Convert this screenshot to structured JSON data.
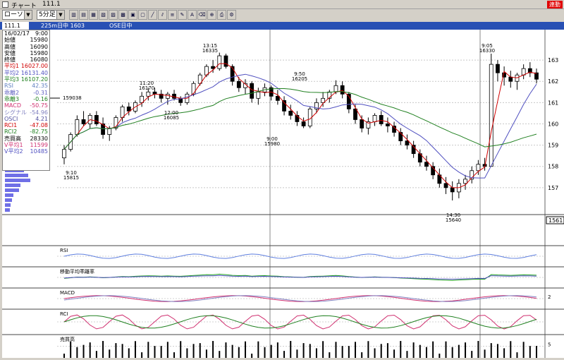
{
  "window": {
    "title": "チャート",
    "symbol": "111.1",
    "link_badge": "連動"
  },
  "toolbar": {
    "chart_type": "ローソク",
    "interval": "5分足",
    "buttons": [
      "chart-a",
      "chart-b",
      "chart-c",
      "chart-d",
      "chart-e",
      "chart-f",
      "chart-g",
      "chart-h",
      "draw-line",
      "draw-channel",
      "draw-fib",
      "draw-pen",
      "draw-text",
      "draw-eraser",
      "zoom",
      "print",
      "settings"
    ]
  },
  "info": {
    "symbol_code": "111.1",
    "contract": "225m日中 1603",
    "market": "OSE日中"
  },
  "data_panel": {
    "date": "16/02/17",
    "time": "9:00",
    "rows": [
      {
        "label": "始値",
        "value": "15980",
        "color": "#000000"
      },
      {
        "label": "高値",
        "value": "16090",
        "color": "#000000"
      },
      {
        "label": "安値",
        "value": "15980",
        "color": "#000000"
      },
      {
        "label": "終値",
        "value": "16080",
        "color": "#000000"
      },
      {
        "label": "平均1",
        "value": "16027.00",
        "color": "#d00000"
      },
      {
        "label": "平均2",
        "value": "16131.40",
        "color": "#5050c0"
      },
      {
        "label": "平均3",
        "value": "16107.20",
        "color": "#208020"
      },
      {
        "label": "RSI",
        "value": "42.35",
        "color": "#6080c0"
      },
      {
        "label": "乖離2",
        "value": "-0.31",
        "color": "#6060c0"
      },
      {
        "label": "乖離3",
        "value": "-0.16",
        "color": "#208020"
      },
      {
        "label": "MACD",
        "value": "-50.75",
        "color": "#d03070"
      },
      {
        "label": "シグナル",
        "value": "-54.96",
        "color": "#8080c0"
      },
      {
        "label": "OSCI",
        "value": "4.21",
        "color": "#5050a0"
      },
      {
        "label": "RCI1",
        "value": "-47.08",
        "color": "#d00000"
      },
      {
        "label": "RCI2",
        "value": "-82.75",
        "color": "#208020"
      },
      {
        "label": "売買高",
        "value": "28330",
        "color": "#000000"
      },
      {
        "label": "V平均1",
        "value": "11599",
        "color": "#d03070"
      },
      {
        "label": "V平均2",
        "value": "10485",
        "color": "#5050c0"
      }
    ]
  },
  "price_axis": {
    "ticks": [
      "163",
      "162",
      "161",
      "160",
      "159",
      "158",
      "157"
    ],
    "current": "1561",
    "marker": "159038"
  },
  "annotations": [
    {
      "time": "9:10",
      "price": "15815"
    },
    {
      "time": "11:20",
      "price": "16170"
    },
    {
      "time": "12:00",
      "price": "16085"
    },
    {
      "time": "13:15",
      "price": "16335"
    },
    {
      "time": "9:50",
      "price": "16205"
    },
    {
      "time": "9:00",
      "price": "15980"
    },
    {
      "time": "14:30",
      "price": "15640"
    },
    {
      "time": "9:05",
      "price": "16330"
    }
  ],
  "sub_panels": [
    {
      "label": "RSI"
    },
    {
      "label": "移動平均乖離率"
    },
    {
      "label": "MACD",
      "axis": "2"
    },
    {
      "label": "RCI"
    },
    {
      "label": "売買高",
      "axis": "5"
    }
  ],
  "volume_profile": [
    14,
    27,
    33,
    36,
    22,
    20,
    12,
    10,
    8,
    7
  ],
  "chart_data": {
    "type": "candlestick",
    "ylim": [
      15600,
      16370
    ],
    "candles": [
      [
        15840,
        15900,
        15810,
        15880
      ],
      [
        15880,
        15960,
        15870,
        15950
      ],
      [
        15950,
        16040,
        15940,
        16020
      ],
      [
        16020,
        16060,
        15990,
        16000
      ],
      [
        16000,
        16050,
        15980,
        16040
      ],
      [
        16040,
        16060,
        15990,
        16000
      ],
      [
        16000,
        16030,
        15930,
        15950
      ],
      [
        15950,
        15990,
        15920,
        15980
      ],
      [
        15980,
        16040,
        15970,
        16030
      ],
      [
        16030,
        16090,
        16010,
        16080
      ],
      [
        16080,
        16100,
        16040,
        16060
      ],
      [
        16060,
        16110,
        16050,
        16100
      ],
      [
        16100,
        16150,
        16080,
        16130
      ],
      [
        16130,
        16170,
        16110,
        16150
      ],
      [
        16150,
        16170,
        16120,
        16140
      ],
      [
        16140,
        16160,
        16100,
        16120
      ],
      [
        16120,
        16150,
        16090,
        16140
      ],
      [
        16140,
        16160,
        16110,
        16120
      ],
      [
        16120,
        16130,
        16085,
        16100
      ],
      [
        16100,
        16150,
        16090,
        16140
      ],
      [
        16140,
        16200,
        16130,
        16190
      ],
      [
        16190,
        16240,
        16180,
        16230
      ],
      [
        16230,
        16280,
        16220,
        16270
      ],
      [
        16270,
        16300,
        16240,
        16260
      ],
      [
        16260,
        16335,
        16250,
        16320
      ],
      [
        16320,
        16330,
        16260,
        16270
      ],
      [
        16270,
        16280,
        16180,
        16200
      ],
      [
        16200,
        16220,
        16150,
        16170
      ],
      [
        16170,
        16210,
        16140,
        16190
      ],
      [
        16190,
        16200,
        16100,
        16120
      ],
      [
        16120,
        16170,
        16090,
        16150
      ],
      [
        16150,
        16190,
        16130,
        16170
      ],
      [
        16170,
        16180,
        16110,
        16130
      ],
      [
        16130,
        16160,
        16090,
        16110
      ],
      [
        16110,
        16130,
        16040,
        16060
      ],
      [
        16060,
        16090,
        16020,
        16040
      ],
      [
        16040,
        16060,
        15990,
        16010
      ],
      [
        16010,
        16030,
        15980,
        15990
      ],
      [
        15990,
        16080,
        15980,
        16070
      ],
      [
        16070,
        16120,
        16050,
        16100
      ],
      [
        16100,
        16150,
        16080,
        16120
      ],
      [
        16120,
        16160,
        16100,
        16150
      ],
      [
        16150,
        16205,
        16140,
        16180
      ],
      [
        16180,
        16200,
        16120,
        16140
      ],
      [
        16140,
        16150,
        16050,
        16070
      ],
      [
        16070,
        16090,
        16000,
        16020
      ],
      [
        16020,
        16040,
        15960,
        15980
      ],
      [
        15980,
        16030,
        15950,
        16010
      ],
      [
        16010,
        16050,
        15990,
        16040
      ],
      [
        16040,
        16060,
        15990,
        16000
      ],
      [
        16000,
        16030,
        15960,
        15990
      ],
      [
        15990,
        16010,
        15940,
        15960
      ],
      [
        15960,
        15980,
        15900,
        15920
      ],
      [
        15920,
        15950,
        15880,
        15900
      ],
      [
        15900,
        15920,
        15840,
        15860
      ],
      [
        15860,
        15880,
        15800,
        15820
      ],
      [
        15820,
        15850,
        15780,
        15800
      ],
      [
        15800,
        15820,
        15740,
        15760
      ],
      [
        15760,
        15790,
        15700,
        15720
      ],
      [
        15720,
        15750,
        15670,
        15700
      ],
      [
        15700,
        15730,
        15640,
        15680
      ],
      [
        15680,
        15740,
        15650,
        15720
      ],
      [
        15720,
        15760,
        15690,
        15740
      ],
      [
        15740,
        15800,
        15720,
        15780
      ],
      [
        15780,
        15830,
        15760,
        15810
      ],
      [
        15810,
        15840,
        15780,
        15800
      ],
      [
        15800,
        16330,
        15800,
        16280
      ],
      [
        16280,
        16300,
        16200,
        16240
      ],
      [
        16240,
        16270,
        16180,
        16220
      ],
      [
        16220,
        16250,
        16170,
        16200
      ],
      [
        16200,
        16240,
        16160,
        16230
      ],
      [
        16230,
        16280,
        16210,
        16260
      ],
      [
        16260,
        16290,
        16220,
        16240
      ],
      [
        16240,
        16260,
        16190,
        16210
      ]
    ]
  }
}
